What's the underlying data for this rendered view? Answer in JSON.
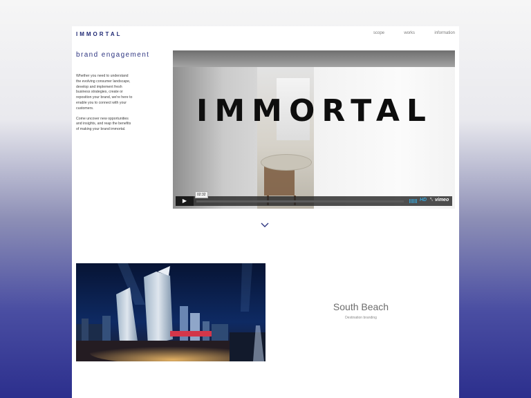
{
  "header": {
    "logo": "IMMORTAL",
    "nav": [
      "scope",
      "works",
      "information"
    ]
  },
  "section": {
    "heading": "brand engagement",
    "paragraphs": [
      "Whether you need to understand the evolving consumer landscape, develop and implement fresh business strategies, create or reposition your brand, we're here to enable you to connect with your customers.",
      "Come uncover new opportunities and insights, and reap the benefits of making your brand immortal."
    ]
  },
  "video": {
    "sign_text": "IMMORTAL",
    "time": "02:32",
    "hd_label": "HD",
    "brand_label": "vimeo",
    "play_icon": "play-icon"
  },
  "scroll": {
    "icon": "chevron-down-icon"
  },
  "project": {
    "title": "South Beach",
    "subtitle": "Destination branding"
  },
  "colors": {
    "brand_blue": "#1f2873",
    "gradient_bottom": "#2c2f8d",
    "vimeo_blue": "#37a6d9"
  }
}
